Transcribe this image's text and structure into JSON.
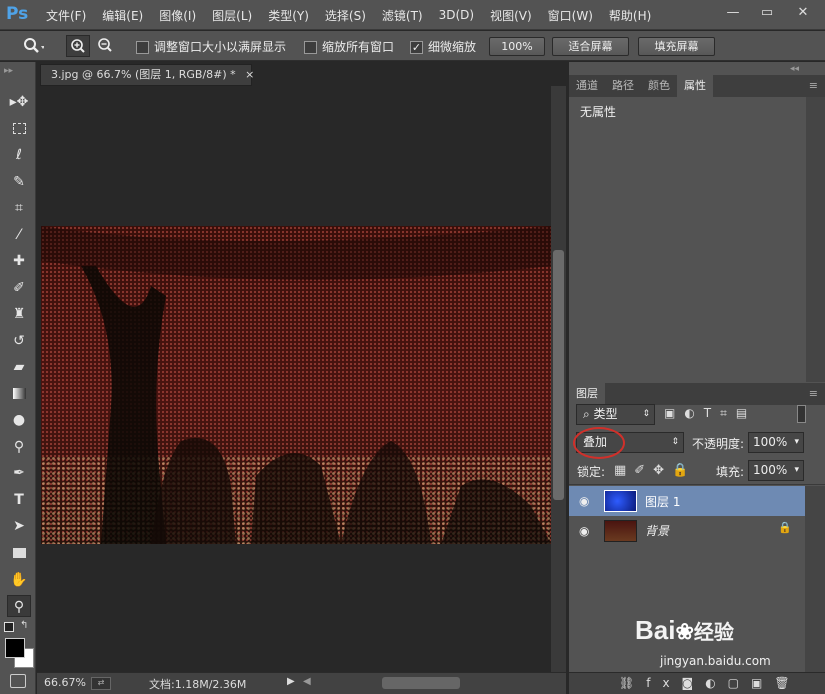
{
  "app": {
    "logo": "Ps"
  },
  "menu": [
    "文件(F)",
    "编辑(E)",
    "图像(I)",
    "图层(L)",
    "类型(Y)",
    "选择(S)",
    "滤镜(T)",
    "3D(D)",
    "视图(V)",
    "窗口(W)",
    "帮助(H)"
  ],
  "window_controls": {
    "minimize": "—",
    "restore": "▭",
    "close": "✕"
  },
  "options": {
    "resize_windows": "调整窗口大小以满屏显示",
    "zoom_all": "缩放所有窗口",
    "scrubby_zoom": "细微缩放",
    "zoom_value": "100%",
    "fit_screen": "适合屏幕",
    "fill_screen": "填充屏幕"
  },
  "document": {
    "tab_title": "3.jpg @ 66.7% (图层 1, RGB/8#) *",
    "close": "×"
  },
  "status": {
    "zoom": "66.67%",
    "doc_info": "文档:1.18M/2.36M"
  },
  "panel_tabs": [
    "通道",
    "路径",
    "颜色",
    "属性"
  ],
  "properties": {
    "text": "无属性"
  },
  "layers_panel": {
    "title": "图层",
    "filter_kind": "类型",
    "blend_mode": "叠加",
    "opacity_label": "不透明度:",
    "opacity_value": "100%",
    "lock_label": "锁定:",
    "fill_label": "填充:",
    "fill_value": "100%",
    "layers": [
      {
        "name": "图层 1",
        "selected": true
      },
      {
        "name": "背景",
        "selected": false
      }
    ]
  },
  "watermark": {
    "brand": "Bai",
    "brand2": "经验",
    "url": "jingyan.baidu.com"
  },
  "colors": {
    "accent": "#4fa3e8",
    "selected_layer": "#6e8ab3",
    "panel": "#535353"
  }
}
